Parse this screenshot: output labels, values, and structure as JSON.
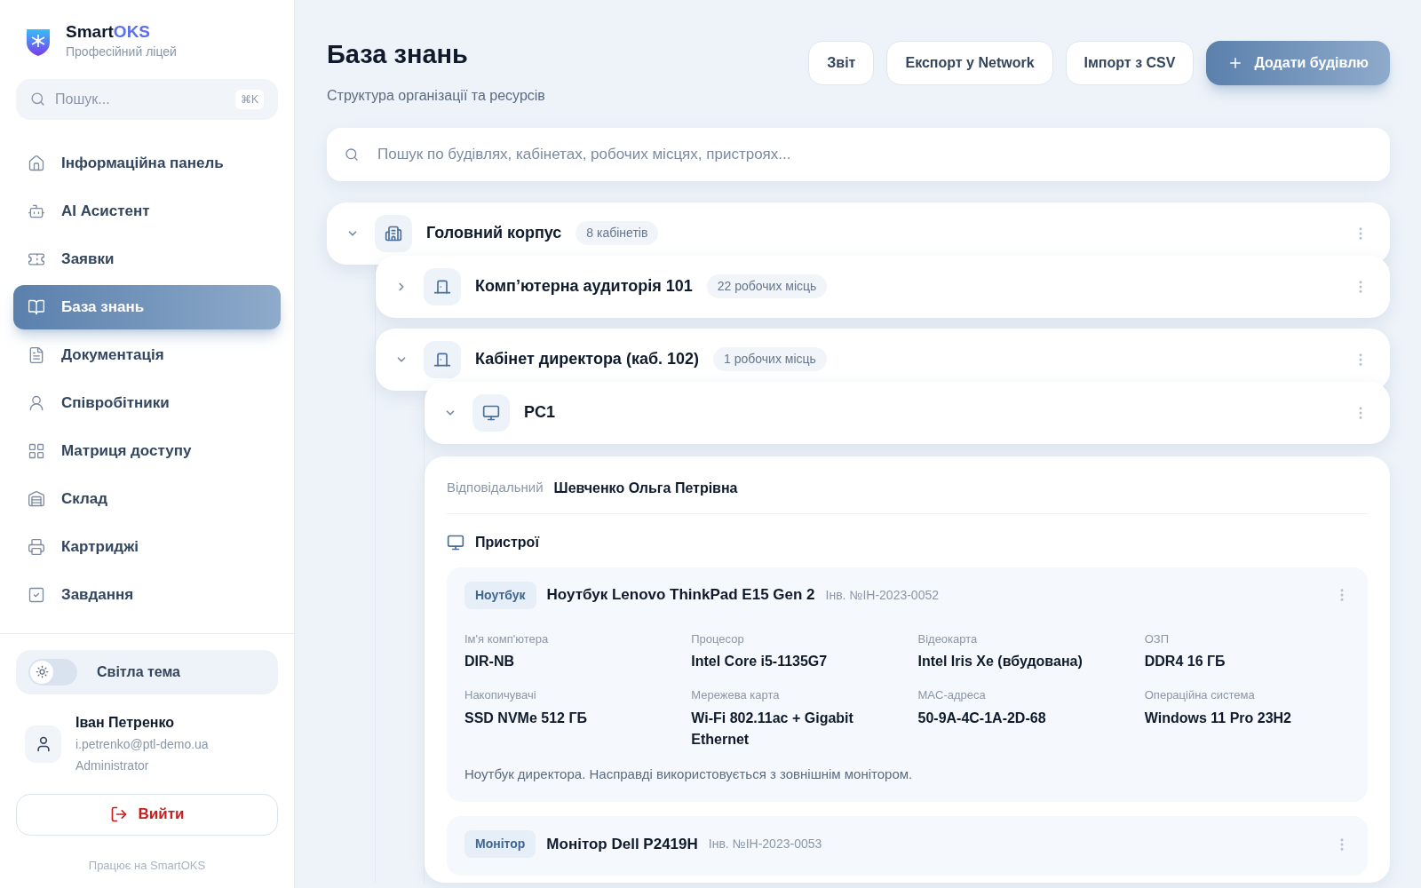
{
  "brand": {
    "name_a": "Smart",
    "name_b": "OKS",
    "subtitle": "Професійний ліцей"
  },
  "sidebar_search": {
    "placeholder": "Пошук...",
    "shortcut": "⌘K"
  },
  "nav": [
    {
      "kind": "home",
      "label": "Інформаційна панель",
      "selected": false
    },
    {
      "kind": "bot",
      "label": "AI Асистент",
      "selected": false
    },
    {
      "kind": "ticket",
      "label": "Заявки",
      "selected": false
    },
    {
      "kind": "book",
      "label": "База знань",
      "selected": true
    },
    {
      "kind": "doc",
      "label": "Документація",
      "selected": false
    },
    {
      "kind": "staff",
      "label": "Співробітники",
      "selected": false
    },
    {
      "kind": "grid",
      "label": "Матриця доступу",
      "selected": false
    },
    {
      "kind": "warehouse",
      "label": "Склад",
      "selected": false
    },
    {
      "kind": "printer",
      "label": "Картриджі",
      "selected": false
    },
    {
      "kind": "task",
      "label": "Завдання",
      "selected": false
    }
  ],
  "theme_toggle": {
    "label": "Світла тема",
    "on": false
  },
  "user": {
    "name": "Іван Петренко",
    "email": "i.petrenko@ptl-demo.ua",
    "role": "Administrator"
  },
  "logout": "Вийти",
  "footer": "Працює на SmartOKS",
  "page": {
    "title": "База знань",
    "subtitle": "Структура організації та ресурсів"
  },
  "actions": [
    {
      "kind": "plain",
      "label": "Звіт"
    },
    {
      "kind": "plain",
      "label": "Експорт у Network"
    },
    {
      "kind": "plain",
      "label": "Імпорт з CSV"
    },
    {
      "kind": "primary",
      "label": "Додати будівлю"
    }
  ],
  "search": {
    "placeholder": "Пошук по будівлях, кабінетах, робочих місцях, пристроях..."
  },
  "tree": [
    {
      "kind": "building",
      "name": "Головний корпус",
      "badge": "8 кабінетів",
      "expanded": true,
      "children": [
        {
          "kind": "room",
          "name": "Комп’ютерна аудиторія 101",
          "badge": "22 робочих місць",
          "expanded": false
        },
        {
          "kind": "room",
          "name": "Кабінет директора (каб. 102)",
          "badge": "1 робочих місць",
          "expanded": true,
          "children": [
            {
              "kind": "workstation",
              "name": "PC1",
              "expanded": true,
              "details": {
                "responsible_label": "Відповідальний",
                "responsible": "Шевченко Ольга Петрівна",
                "devices_title": "Пристрої",
                "devices": [
                  {
                    "tag": "Ноутбук",
                    "name": "Ноутбук Lenovo ThinkPad E15 Gen 2",
                    "inventory": "Інв. №ІН-2023-0052",
                    "specs": [
                      {
                        "label": "Ім'я комп'ютера",
                        "value": "DIR-NB"
                      },
                      {
                        "label": "Процесор",
                        "value": "Intel Core i5-1135G7"
                      },
                      {
                        "label": "Відеокарта",
                        "value": "Intel Iris Xe (вбудована)"
                      },
                      {
                        "label": "ОЗП",
                        "value": "DDR4 16 ГБ"
                      },
                      {
                        "label": "Накопичувачі",
                        "value": "SSD NVMe 512 ГБ"
                      },
                      {
                        "label": "Мережева карта",
                        "value": "Wi-Fi 802.11ac + Gigabit Ethernet"
                      },
                      {
                        "label": "MAC-адреса",
                        "value": "50-9A-4C-1A-2D-68"
                      },
                      {
                        "label": "Операційна система",
                        "value": "Windows 11 Pro 23H2"
                      }
                    ],
                    "note": "Ноутбук директора. Насправді використовується з зовнішнім монітором."
                  },
                  {
                    "tag": "Монітор",
                    "name": "Монітор Dell P2419H",
                    "inventory": "Інв. №ІН-2023-0053"
                  }
                ]
              }
            }
          ]
        }
      ]
    }
  ]
}
